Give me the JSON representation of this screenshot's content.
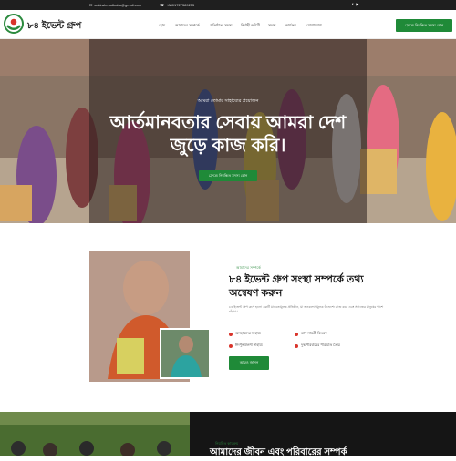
{
  "topbar": {
    "email": "zakirahmudbabu@gmail.com",
    "phone": "+8801727389255",
    "social": [
      "facebook-icon",
      "youtube-icon"
    ]
  },
  "header": {
    "brand": "৮৪ ইভেন্ট গ্রুপ",
    "nav": [
      "হোম",
      "আমাদের সম্পর্কে",
      "প্রতিষ্ঠাতা সদস্য",
      "নির্বাহী কমিটি",
      "সদস্য",
      "কার্যক্রম",
      "যোগাযোগ"
    ],
    "cta": "ফ্রেন্ডে নিবন্ধিত সদস্য হোন"
  },
  "hero": {
    "eyebrow": "আমরা তোমার সাহায্যের প্রয়োজন",
    "title": "আর্তমানবতার সেবায় আমরা দেশ জুড়ে কাজ করি।",
    "button": "ফ্রেন্ডে নিবন্ধিত সদস্য হোন"
  },
  "about": {
    "eyebrow": "আমাদের সম্পর্কে",
    "title": "৮৪ ইভেন্ট গ্রুপ সংস্থা সম্পর্কে তথ্য অন্বেষণ করুন",
    "text": "৮৪ ইভেন্ট গ্রুপ রুপে হলো একটি মানবতামূলক প্রতিষ্ঠান, যা জনকল্যাণমূলক উদ্দেশ্যে কাজ করে এবং সমাজের মানুষের পাশে দাঁড়ায়।",
    "features": [
      "অসহায়দের সাহায্য",
      "ত্রাণ সামগ্রী বিতরণ",
      "ঈদপুনর্মিলনী সাহায্য",
      "দুস্থ পরিবারের পরিচিতি তৈরি"
    ],
    "button": "আরও জানুন"
  },
  "section2": {
    "eyebrow": "নিয়মিত কার্যক্রম",
    "title": "আমাদের জীবন এবং পরিবারের সম্পর্ক"
  }
}
